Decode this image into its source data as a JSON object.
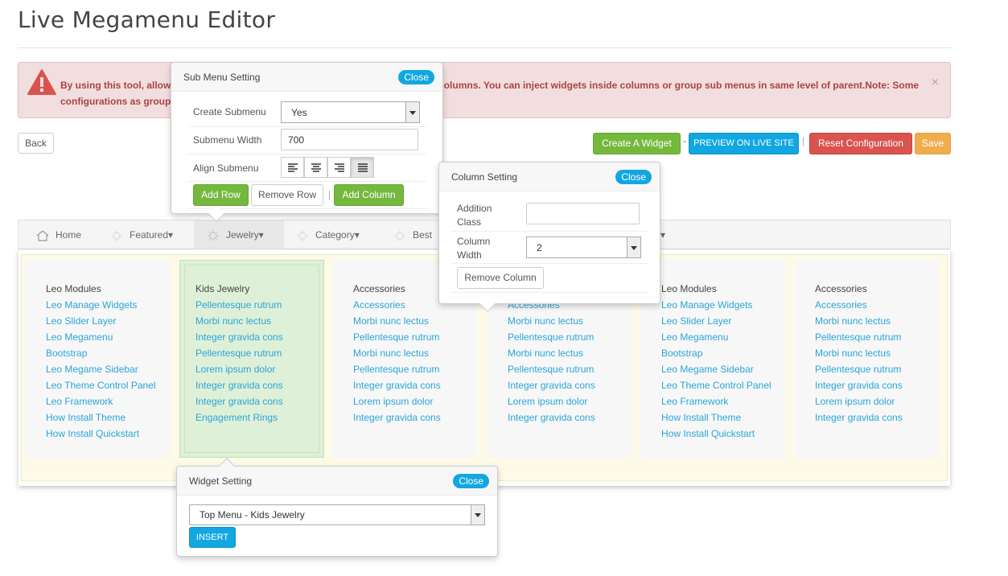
{
  "page": {
    "title": "Live Megamenu Editor"
  },
  "alert": {
    "text": "By using this tool, allow to add new sub menus having multiple rows and multiple columns. You can inject widgets inside columns or group sub menus in same level of parent.Note: Some configurations as group and columns width setting will be overrided",
    "close": "×",
    "color": "#a94442"
  },
  "toolbar": {
    "back": "Back",
    "create_widget": "Create A Widget",
    "sep1": "-",
    "preview": "PREVIEW ON LIVE SITE",
    "sep2": "|",
    "reset": "Reset Configuration",
    "save": "Save"
  },
  "nav": {
    "items": [
      {
        "label": "Home",
        "icon": "home-icon"
      },
      {
        "label": "Featured▾",
        "icon": "sparkle-icon"
      },
      {
        "label": "Jewelry▾",
        "icon": "gear-icon"
      },
      {
        "label": "Category▾",
        "icon": "sparkle-icon"
      },
      {
        "label": "Best",
        "icon": "sparkle-icon"
      },
      {
        "label": "▾",
        "icon": ""
      }
    ]
  },
  "columns": [
    {
      "heading": "Leo Modules",
      "links": [
        "Leo Manage Widgets",
        "Leo Slider Layer",
        "Leo Megamenu",
        "Bootstrap",
        "Leo Megame Sidebar",
        "Leo Theme Control Panel",
        "Leo Framework",
        "How Install Theme",
        "How Install Quickstart"
      ]
    },
    {
      "heading": "Kids Jewelry",
      "links": [
        "Pellentesque rutrum",
        "Morbi nunc lectus",
        "Integer gravida cons",
        "Pellentesque rutrum",
        "Lorem ipsum dolor",
        "Integer gravida cons",
        "Integer gravida cons",
        "Engagement Rings"
      ]
    },
    {
      "heading": "Accessories",
      "links": [
        "Accessories",
        "Morbi nunc lectus",
        "Pellentesque rutrum",
        "Morbi nunc lectus",
        "Pellentesque rutrum",
        "Integer gravida cons",
        "Lorem ipsum dolor",
        "Integer gravida cons"
      ]
    },
    {
      "heading": "",
      "links": [
        "Accessories",
        "Morbi nunc lectus",
        "Pellentesque rutrum",
        "Morbi nunc lectus",
        "Pellentesque rutrum",
        "Integer gravida cons",
        "Lorem ipsum dolor",
        "Integer gravida cons"
      ]
    },
    {
      "heading": "Leo Modules",
      "links": [
        "Leo Manage Widgets",
        "Leo Slider Layer",
        "Leo Megamenu",
        "Bootstrap",
        "Leo Megame Sidebar",
        "Leo Theme Control Panel",
        "Leo Framework",
        "How Install Theme",
        "How Install Quickstart"
      ]
    },
    {
      "heading": "Accessories",
      "links": [
        "Accessories",
        "Morbi nunc lectus",
        "Pellentesque rutrum",
        "Morbi nunc lectus",
        "Pellentesque rutrum",
        "Integer gravida cons",
        "Lorem ipsum dolor",
        "Integer gravida cons"
      ]
    }
  ],
  "submenu_popover": {
    "title": "Sub Menu Setting",
    "close": "Close",
    "create_label": "Create Submenu",
    "create_value": "Yes",
    "width_label": "Submenu Width",
    "width_value": "700",
    "align_label": "Align Submenu",
    "align_options": [
      "align-left-icon",
      "align-center-icon",
      "align-right-icon",
      "align-justify-icon"
    ],
    "add_row": "Add Row",
    "remove_row": "Remove Row",
    "add_column": "Add Column"
  },
  "column_popover": {
    "title": "Column Setting",
    "close": "Close",
    "class_label": "Addition Class",
    "class_value": "",
    "width_label": "Column Width",
    "width_value": "2",
    "remove": "Remove Column"
  },
  "widget_popover": {
    "title": "Widget Setting",
    "close": "Close",
    "select_value": "Top Menu - Kids Jewelry",
    "insert": "INSERT"
  }
}
